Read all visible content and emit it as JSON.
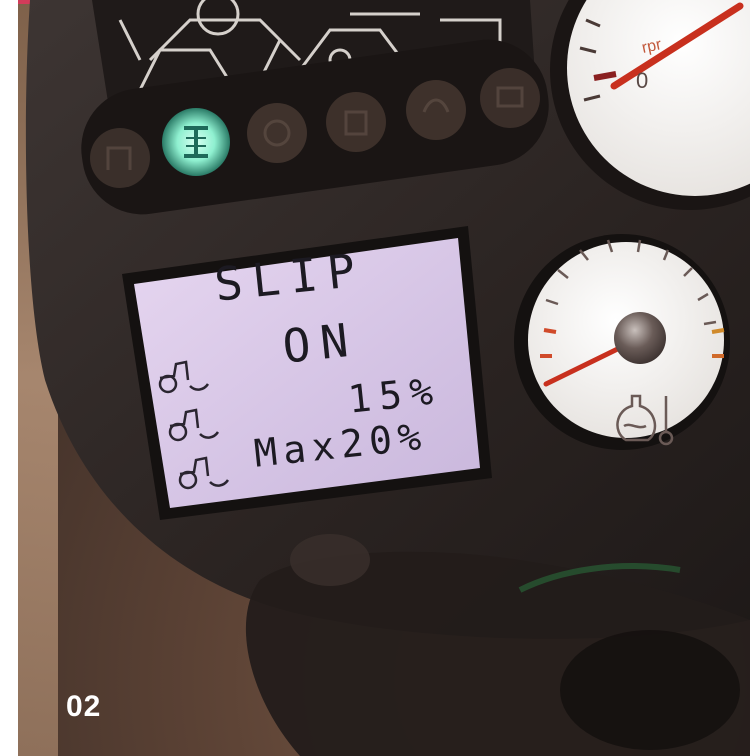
{
  "lcd": {
    "title": "SLIP",
    "state": "ON",
    "current": "15%",
    "max": "Max20%"
  },
  "gauge": {
    "label": "rpr"
  },
  "page_number": "02",
  "indicators": [
    {
      "name": "tractor-icon",
      "lit": false
    },
    {
      "name": "four-wheel-drive-icon",
      "lit": true,
      "color": "#bfffea"
    },
    {
      "name": "gear-icon",
      "lit": false
    },
    {
      "name": "hydraulics-icon",
      "lit": false
    },
    {
      "name": "pto-icon",
      "lit": false
    },
    {
      "name": "camera-icon",
      "lit": false
    }
  ],
  "colors": {
    "dashboard": "#2e2725",
    "lcd_background": "#d8c8e8",
    "needle": "#c8301e",
    "indicator_lit": "#8ff0d0",
    "accent_stripe": "#d23c5a"
  }
}
